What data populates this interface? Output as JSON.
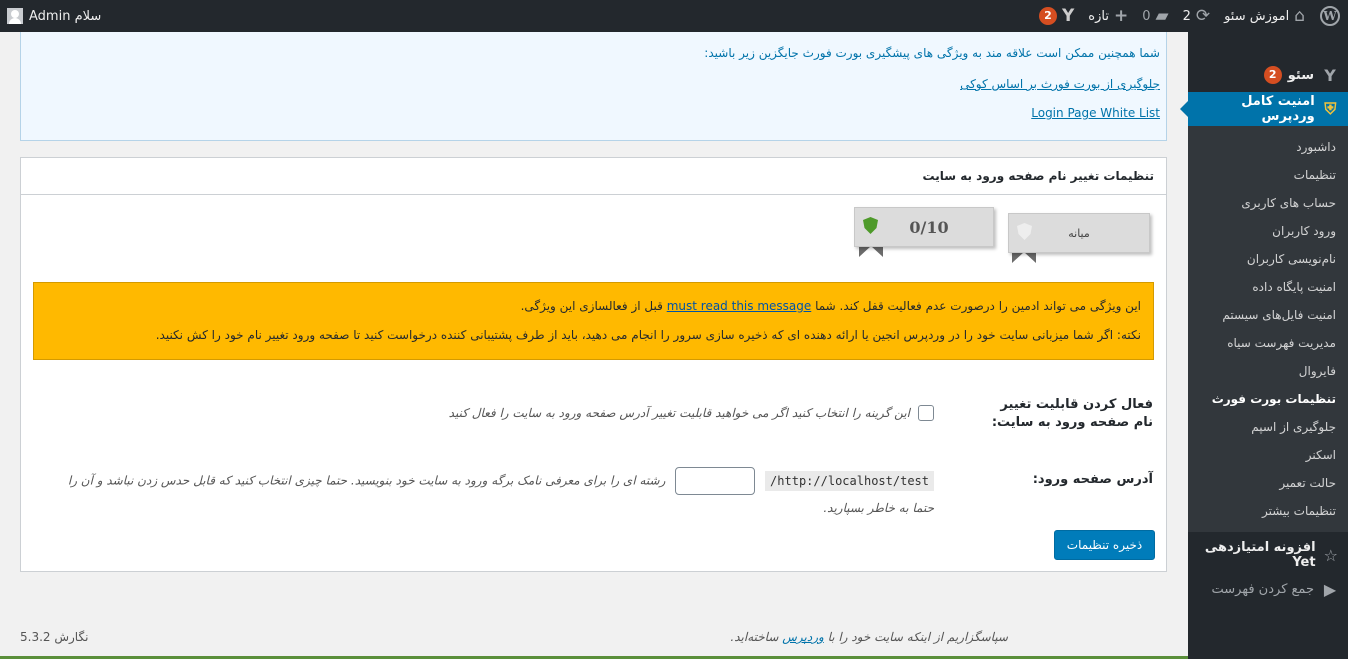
{
  "adminbar": {
    "site_name": "اموزش سئو",
    "updates_count": "2",
    "comments_count": "0",
    "new_label": "تازه",
    "yoast_badge": "2",
    "greeting": "سلام Admin"
  },
  "sidebar": {
    "seo_label": "سئو",
    "seo_badge": "2",
    "security_label": "امنیت کامل وردپرس",
    "submenu": [
      "داشبورد",
      "تنظیمات",
      "حساب های کاربری",
      "ورود کاربران",
      "نام‌نویسی کاربران",
      "امنیت پایگاه داده",
      "امنیت فایل‌های سیستم",
      "مدیریت فهرست سیاه",
      "فایروال",
      "تنظیمات بورت فورث",
      "جلوگیری از اسپم",
      "اسکنر",
      "حالت تعمیر",
      "تنظیمات بیشتر"
    ],
    "yet_label": "افزونه امتیازدهی Yet",
    "collapse_label": "جمع کردن فهرست"
  },
  "infobox": {
    "text": "شما همچنین ممکن است علاقه مند به ویژگی های پیشگیری بورت فورث جایگزین زیر باشید:",
    "link1": "جلوگیری از بورت فورث بر اساس کوکی",
    "link2": "Login Page White List"
  },
  "panel": {
    "title": "تنظیمات تغییر نام صفحه ورود به سایت",
    "level_label": "میانه",
    "score": "0/10",
    "warning_line1_a": "این ویژگی می تواند ادمین را درصورت عدم فعالیت قفل کند. شما",
    "warning_link": "must read this message",
    "warning_line1_b": "قبل از فعالسازی این ویژگی.",
    "warning_line2": "نکته: اگر شما میزبانی سایت خود را در وردپرس انجین یا ارائه دهنده ای که ذخیره سازی سرور را انجام می دهید، باید از طرف پشتیبانی کننده درخواست کنید تا صفحه ورود تغییر نام خود را کش نکنید.",
    "enable_label": "فعال کردن قابلیت تغییر نام صفحه ورود به سایت:",
    "enable_desc": "این گرینه را انتخاب کنید اگر می خواهید قابلیت تغییر آدرس صفحه ورود به سایت را فعال کنید",
    "address_label": "آدرس صفحه ورود:",
    "url_prefix": "http://localhost/test/",
    "address_desc": "رشته ای را برای معرفی نامک برگه ورود به سایت خود بنویسید. حتما چیزی انتخاب کنید که قابل حدس زدن نباشد و آن را حتما به خاطر بسپارید.",
    "save_button": "ذخیره تنظیمات"
  },
  "footer": {
    "thanks_a": "سپاسگزاریم از اینکه سایت خود را با",
    "thanks_link": "وردپرس",
    "thanks_b": "ساخته‌اید.",
    "version": "نگارش 5.3.2"
  }
}
